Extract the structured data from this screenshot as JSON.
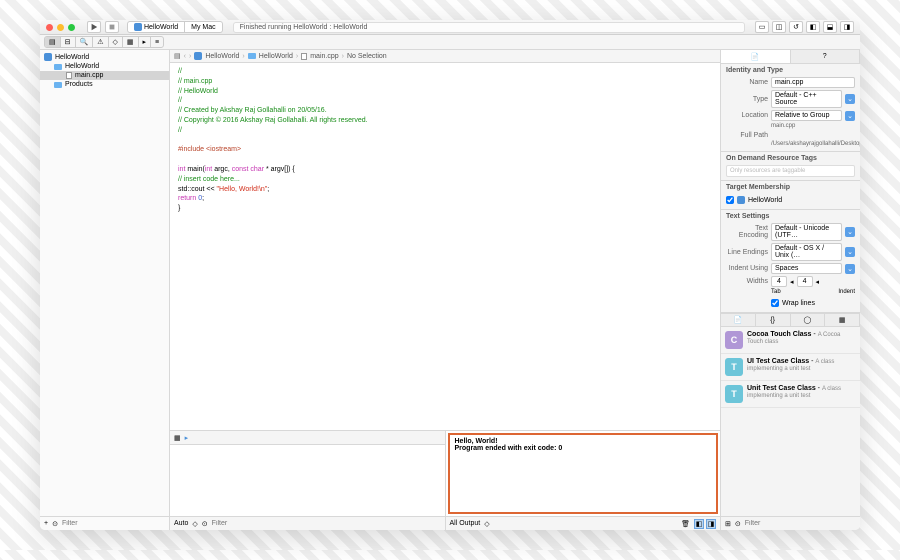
{
  "window": {
    "scheme_target": "HelloWorld",
    "scheme_device": "My Mac",
    "status": "Finished running HelloWorld : HelloWorld"
  },
  "navigator": {
    "root": "HelloWorld",
    "group": "HelloWorld",
    "file": "main.cpp",
    "products": "Products",
    "add": "+",
    "filter_placeholder": "Filter"
  },
  "breadcrumbs": [
    "HelloWorld",
    "HelloWorld",
    "main.cpp",
    "No Selection"
  ],
  "code": {
    "l1": "//",
    "l2": "//  main.cpp",
    "l3": "//  HelloWorld",
    "l4": "//",
    "l5": "//  Created by Akshay Raj Gollahalli on 20/05/16.",
    "l6": "//  Copyright © 2016 Akshay Raj Gollahalli. All rights reserved.",
    "l7": "//",
    "inc": "#include",
    "inc_arg": "<iostream>",
    "kw_int": "int",
    "kw_const": "const",
    "kw_char": "char",
    "kw_return": "return",
    "main_sig1": " main(",
    "main_sig2": " argc, ",
    "main_sig3": " * argv[]) {",
    "comment_insert": "    // insert code here...",
    "cout1": "    std::cout << ",
    "cout_str": "\"Hello, World!\\n\"",
    "cout2": ";",
    "ret_val": "0",
    "ret_semi": ";",
    "brace": "}"
  },
  "debug": {
    "auto": "Auto",
    "filter": "Filter",
    "all_output": "All Output",
    "console_l1": "Hello, World!",
    "console_l2": "Program ended with exit code: 0"
  },
  "inspector": {
    "identity_hdr": "Identity and Type",
    "name_lbl": "Name",
    "name_val": "main.cpp",
    "type_lbl": "Type",
    "type_val": "Default - C++ Source",
    "loc_lbl": "Location",
    "loc_val": "Relative to Group",
    "loc_file": "main.cpp",
    "path_lbl": "Full Path",
    "path_val": "/Users/akshayrajgollahalli/Desktop/HelloWorld/HelloWorld/main.cpp",
    "odr_hdr": "On Demand Resource Tags",
    "odr_placeholder": "Only resources are taggable",
    "target_hdr": "Target Membership",
    "target_name": "HelloWorld",
    "text_hdr": "Text Settings",
    "enc_lbl": "Text Encoding",
    "enc_val": "Default - Unicode (UTF…",
    "eol_lbl": "Line Endings",
    "eol_val": "Default - OS X / Unix (…",
    "indent_lbl": "Indent Using",
    "indent_val": "Spaces",
    "widths_lbl": "Widths",
    "tab_val": "4",
    "tab_lbl": "Tab",
    "indent_val2": "4",
    "indent_lbl2": "Indent",
    "wrap": "Wrap lines"
  },
  "library": [
    {
      "icon": "C",
      "color": "#b097d6",
      "title": "Cocoa Touch Class",
      "desc": "A Cocoa Touch class"
    },
    {
      "icon": "T",
      "color": "#6cc5d9",
      "title": "UI Test Case Class",
      "desc": "A class implementing a unit test"
    },
    {
      "icon": "T",
      "color": "#6cc5d9",
      "title": "Unit Test Case Class",
      "desc": "A class implementing a unit test"
    }
  ],
  "library_filter": "Filter"
}
